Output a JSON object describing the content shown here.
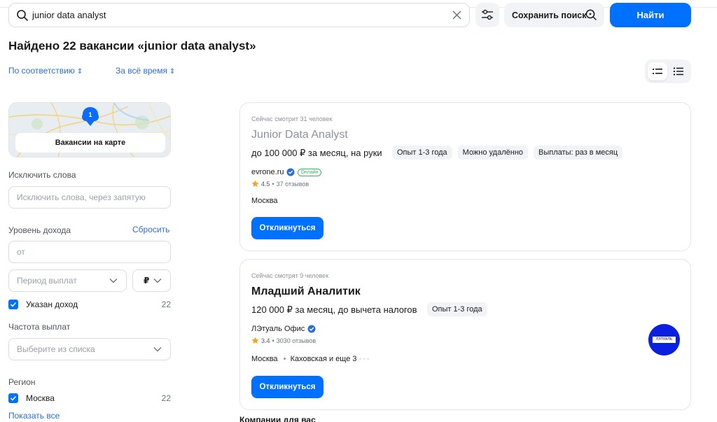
{
  "search": {
    "query": "junior data analyst",
    "save_label": "Сохранить поиск",
    "find_label": "Найти"
  },
  "page": {
    "title": "Найдено 22 вакансии «junior data analyst»"
  },
  "sorting": {
    "relevance": "По соответствию",
    "period": "За всё время"
  },
  "icons": [
    "search-icon",
    "clear-icon",
    "filter-sliders-icon",
    "save-search-icon",
    "list-compact-icon",
    "list-detailed-icon",
    "map-pin-icon",
    "chevron-down-icon",
    "check-icon",
    "verified-icon",
    "star-icon"
  ],
  "colors": {
    "accent": "#0070ff",
    "link": "#2b6fd6",
    "online": "#33b860",
    "star": "#f5a623",
    "logo": "#0a1fe0"
  },
  "filters": {
    "map_pin_count": "1",
    "map_button": "Вакансии на карте",
    "exclude_words_label": "Исключить слова",
    "exclude_words_placeholder": "Исключить слова, через запятую",
    "income_label": "Уровень дохода",
    "income_reset": "Сбросить",
    "income_from_placeholder": "от",
    "payment_period_placeholder": "Период выплат",
    "currency": "₽",
    "income_specified_label": "Указан доход",
    "income_specified_count": "22",
    "payment_frequency_label": "Частота выплат",
    "payment_frequency_placeholder": "Выберите из списка",
    "region_label": "Регион",
    "region_moscow": "Москва",
    "region_moscow_count": "22",
    "show_all": "Показать все"
  },
  "vacancies": [
    {
      "watching": "Сейчас смотрит 31 человек",
      "title": "Junior Data Analyst",
      "salary": "до 100 000 ₽ за месяц, на руки",
      "chips": [
        "Опыт 1-3 года",
        "Можно удалённо",
        "Выплаты: раз в месяц"
      ],
      "company": "evrone.ru",
      "company_badge": "Онлайн",
      "rating": "4.5",
      "reviews": "37 отзывов",
      "city": "Москва",
      "respond": "Откликнуться"
    },
    {
      "watching": "Сейчас смотрят 9 человек",
      "title": "Младший Аналитик",
      "salary": "120 000 ₽ за месяц, до вычета налогов",
      "chips": [
        "Опыт 1-3 года"
      ],
      "company": "ЛЭтуаль Офис",
      "rating": "3.4",
      "reviews": "3030 отзывов",
      "city": "Москва",
      "metro": "Каховская и еще 3",
      "logo_text": "ЛЭТУАЛЬ",
      "respond": "Откликнуться"
    }
  ],
  "bottom_peek": "Компании для вас"
}
